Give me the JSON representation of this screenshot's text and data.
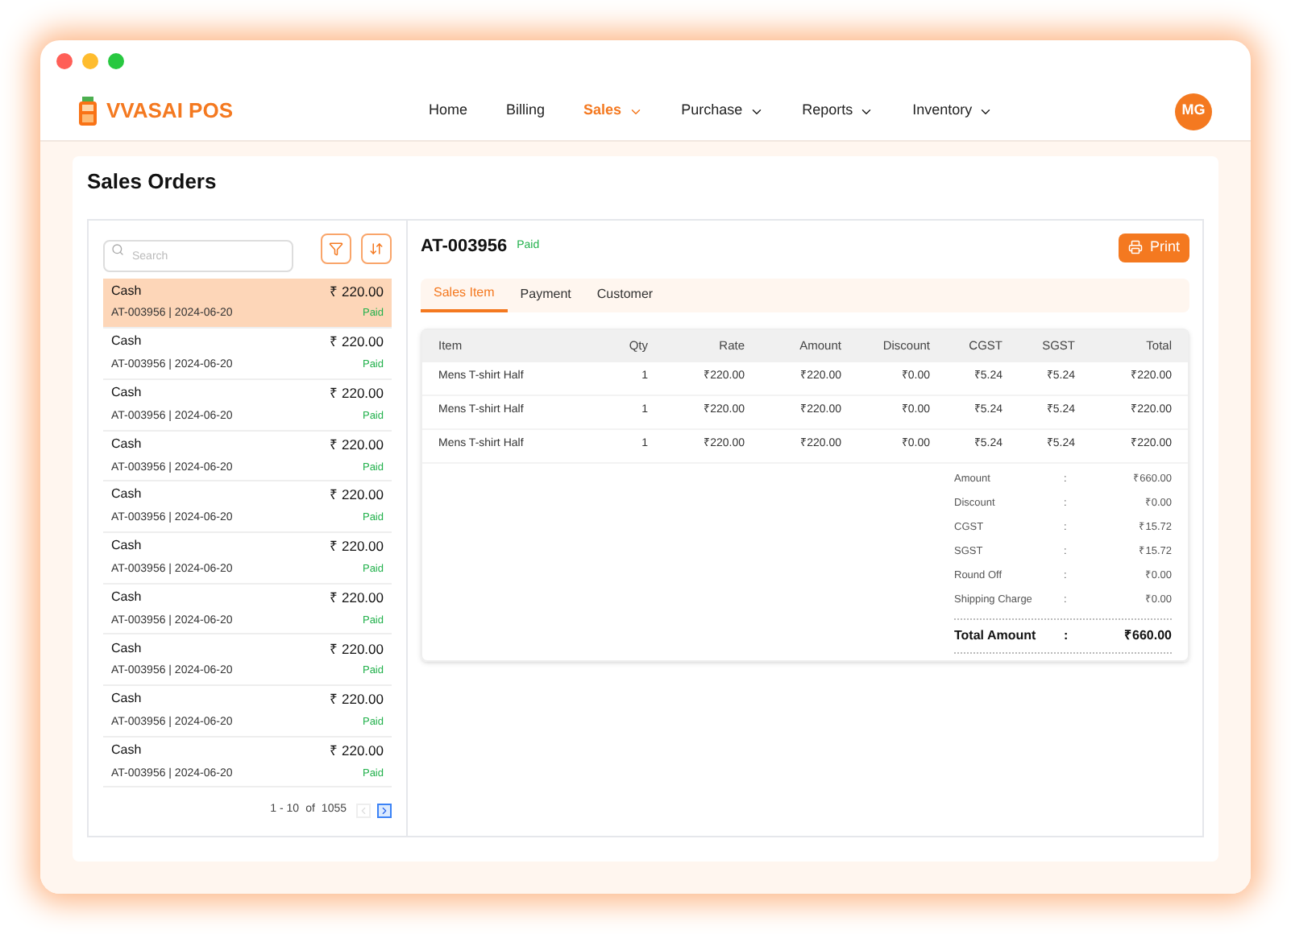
{
  "brand": "VVASAI POS",
  "nav": [
    {
      "label": "Home",
      "selected": false,
      "dropdown": false
    },
    {
      "label": "Billing",
      "selected": false,
      "dropdown": false
    },
    {
      "label": "Sales",
      "selected": true,
      "dropdown": true
    },
    {
      "label": "Purchase",
      "selected": false,
      "dropdown": true
    },
    {
      "label": "Reports",
      "selected": false,
      "dropdown": true
    },
    {
      "label": "Inventory",
      "selected": false,
      "dropdown": true
    }
  ],
  "avatar": "MG",
  "page_title": "Sales Orders",
  "search": {
    "placeholder": "Search"
  },
  "orders": [
    {
      "method": "Cash",
      "amount": "₹ 220.00",
      "ref": "AT-003956 | 2024-06-20",
      "status": "Paid",
      "selected": true
    },
    {
      "method": "Cash",
      "amount": "₹ 220.00",
      "ref": "AT-003956 | 2024-06-20",
      "status": "Paid",
      "selected": false
    },
    {
      "method": "Cash",
      "amount": "₹ 220.00",
      "ref": "AT-003956 | 2024-06-20",
      "status": "Paid",
      "selected": false
    },
    {
      "method": "Cash",
      "amount": "₹ 220.00",
      "ref": "AT-003956 | 2024-06-20",
      "status": "Paid",
      "selected": false
    },
    {
      "method": "Cash",
      "amount": "₹ 220.00",
      "ref": "AT-003956 | 2024-06-20",
      "status": "Paid",
      "selected": false
    },
    {
      "method": "Cash",
      "amount": "₹ 220.00",
      "ref": "AT-003956 | 2024-06-20",
      "status": "Paid",
      "selected": false
    },
    {
      "method": "Cash",
      "amount": "₹ 220.00",
      "ref": "AT-003956 | 2024-06-20",
      "status": "Paid",
      "selected": false
    },
    {
      "method": "Cash",
      "amount": "₹ 220.00",
      "ref": "AT-003956 | 2024-06-20",
      "status": "Paid",
      "selected": false
    },
    {
      "method": "Cash",
      "amount": "₹ 220.00",
      "ref": "AT-003956 | 2024-06-20",
      "status": "Paid",
      "selected": false
    },
    {
      "method": "Cash",
      "amount": "₹ 220.00",
      "ref": "AT-003956 | 2024-06-20",
      "status": "Paid",
      "selected": false
    }
  ],
  "pagination": {
    "range": "1 - 10",
    "of": "of",
    "total": "1055",
    "prev_disabled": true,
    "next_disabled": false
  },
  "detail": {
    "order_id": "AT-003956",
    "status": "Paid",
    "print": "Print"
  },
  "tabs": [
    {
      "label": "Sales Item",
      "selected": true
    },
    {
      "label": "Payment",
      "selected": false
    },
    {
      "label": "Customer",
      "selected": false
    }
  ],
  "table": {
    "columns": [
      "Item",
      "Qty",
      "Rate",
      "Amount",
      "Discount",
      "CGST",
      "SGST",
      "Total"
    ],
    "rows": [
      [
        "Mens T-shirt Half",
        "1",
        "₹220.00",
        "₹220.00",
        "₹0.00",
        "₹5.24",
        "₹5.24",
        "₹220.00"
      ],
      [
        "Mens T-shirt Half",
        "1",
        "₹220.00",
        "₹220.00",
        "₹0.00",
        "₹5.24",
        "₹5.24",
        "₹220.00"
      ],
      [
        "Mens T-shirt Half",
        "1",
        "₹220.00",
        "₹220.00",
        "₹0.00",
        "₹5.24",
        "₹5.24",
        "₹220.00"
      ]
    ]
  },
  "summary": [
    {
      "label": "Amount",
      "sep": ":",
      "value": "₹660.00"
    },
    {
      "label": "Discount",
      "sep": ":",
      "value": "₹0.00"
    },
    {
      "label": "CGST",
      "sep": ":",
      "value": "₹15.72"
    },
    {
      "label": "SGST",
      "sep": ":",
      "value": "₹15.72"
    },
    {
      "label": "Round Off",
      "sep": ":",
      "value": "₹0.00"
    },
    {
      "label": "Shipping Charge",
      "sep": ":",
      "value": "₹0.00"
    }
  ],
  "total": {
    "label": "Total Amount",
    "sep": ":",
    "value": "₹660.00"
  }
}
